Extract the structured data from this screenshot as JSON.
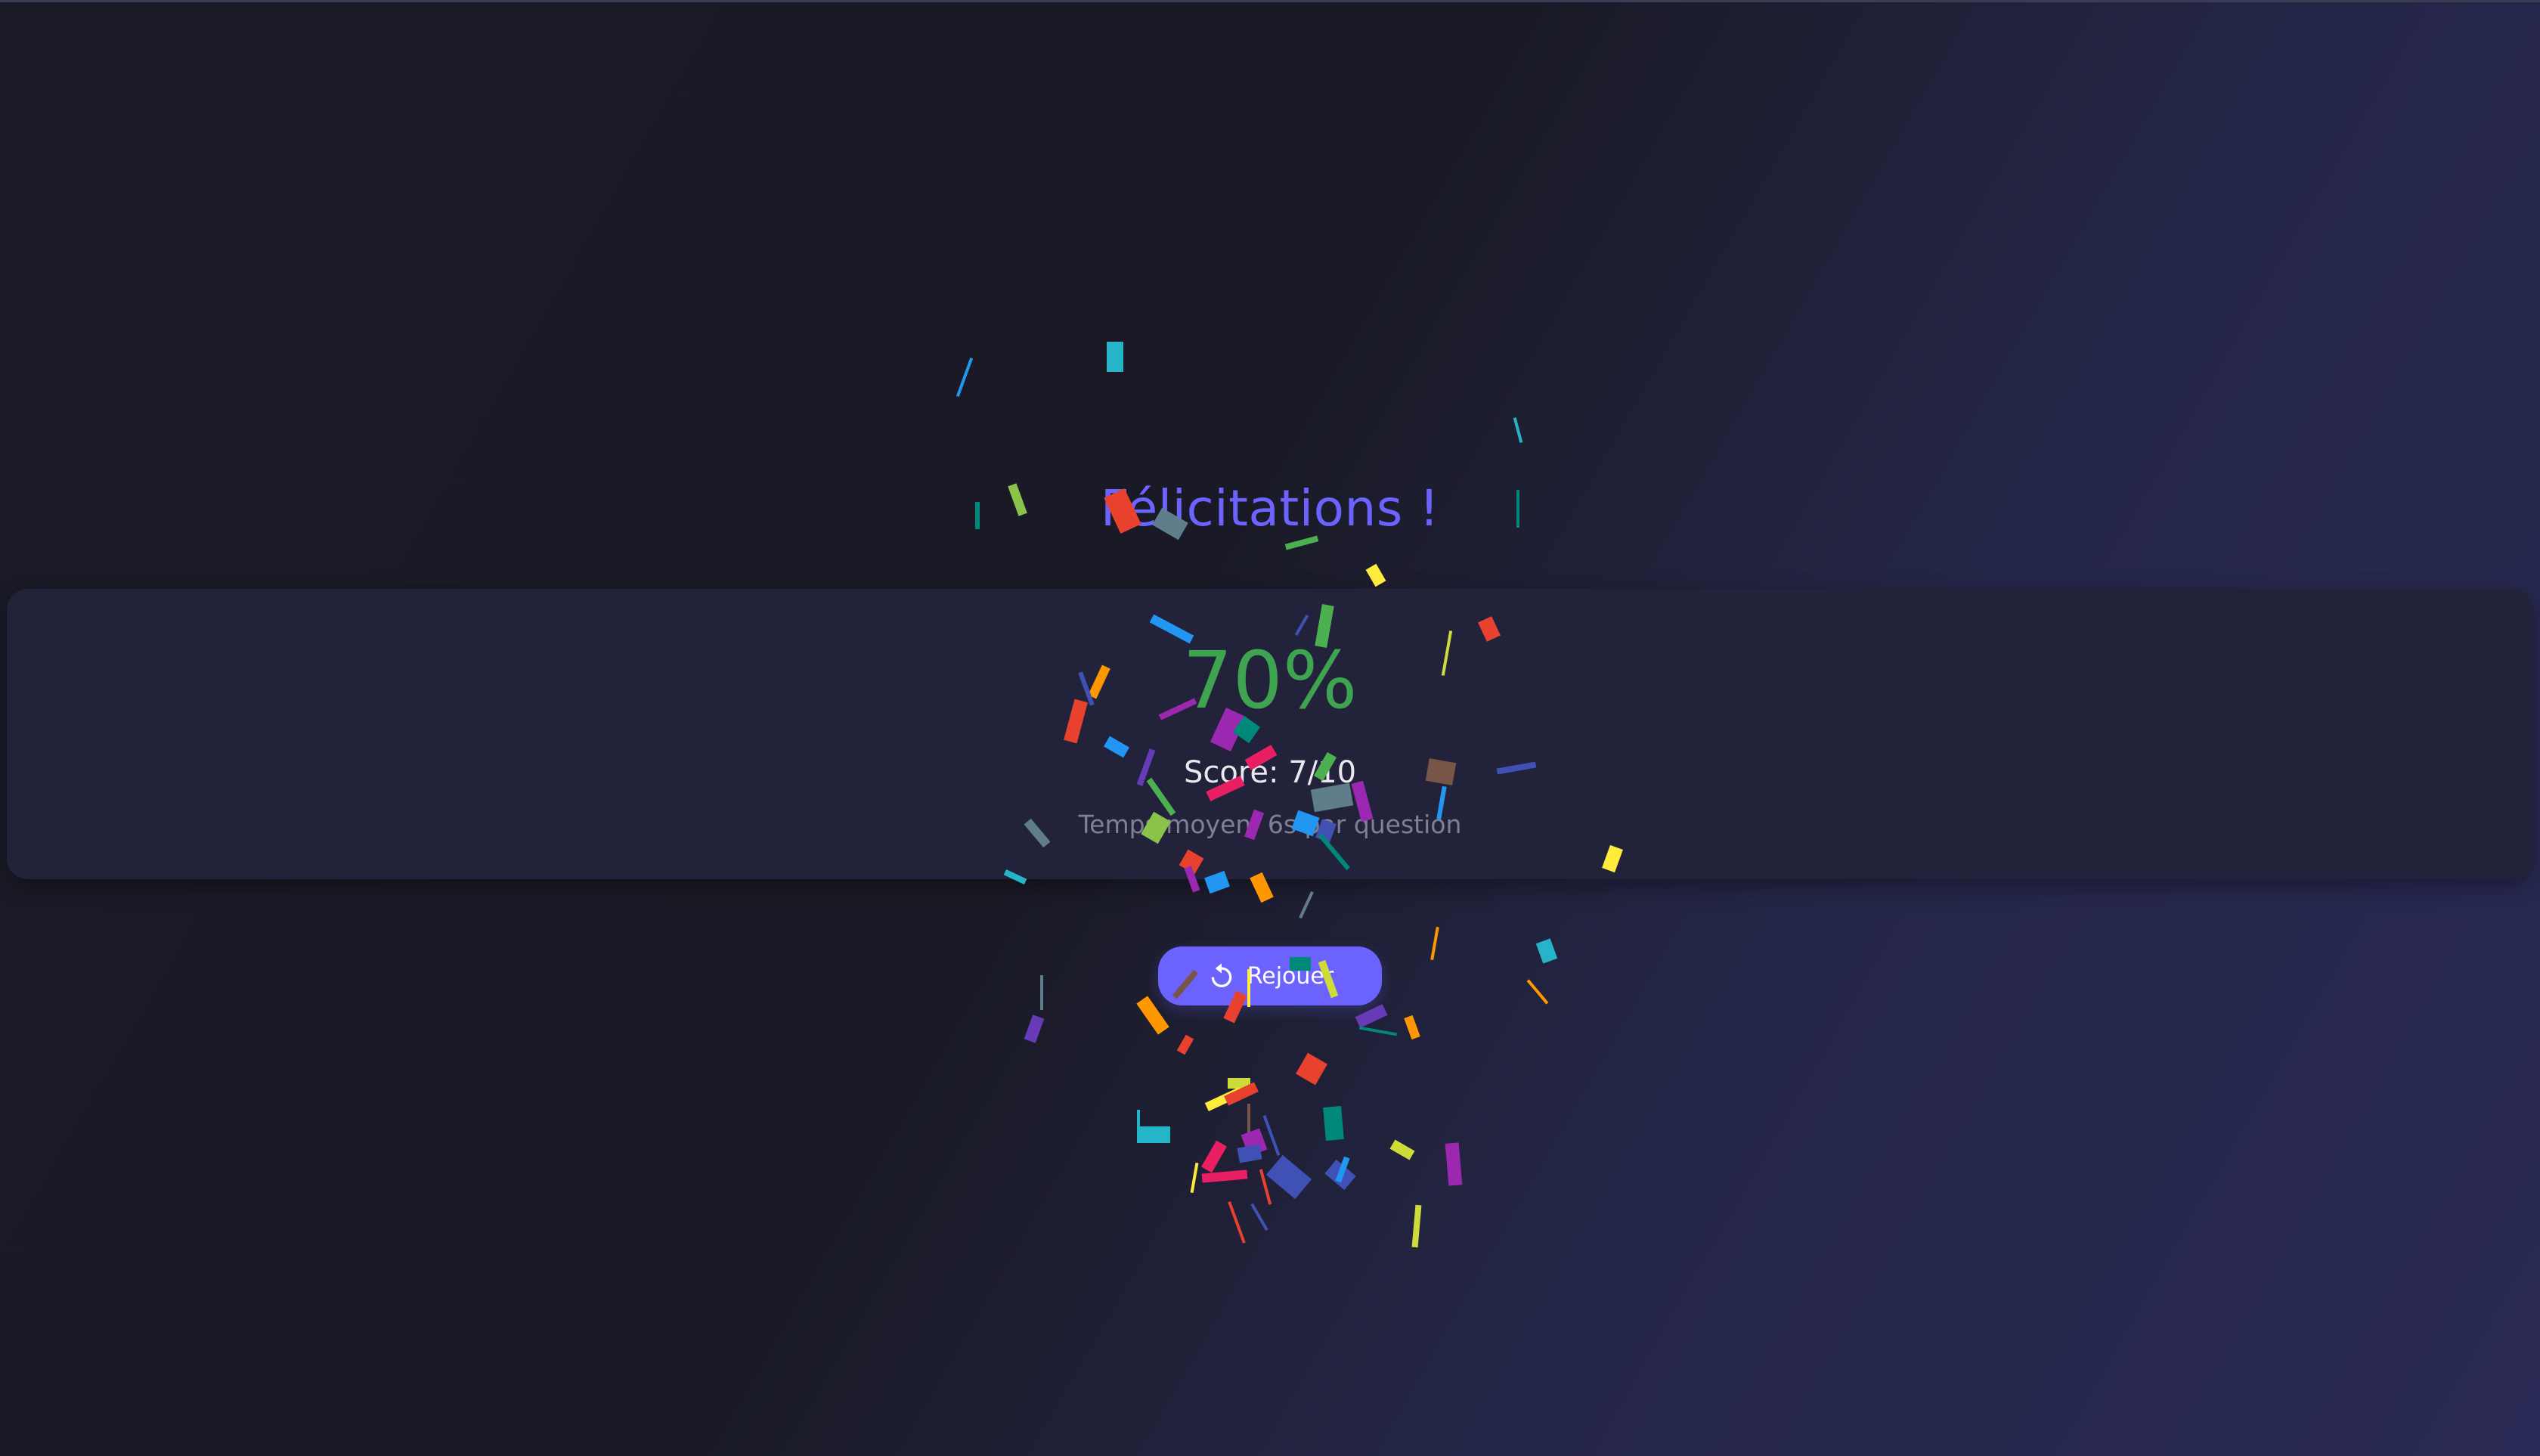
{
  "title": "Félicitations !",
  "result": {
    "percent": "70%",
    "score": "Score: 7/10",
    "avg_time": "Temps moyen: 6s par question"
  },
  "replay": {
    "label": "Rejouer",
    "icon": "refresh-icon"
  },
  "colors": {
    "accent": "#6c63ff",
    "success": "#3fa450",
    "card": "#22233a"
  },
  "confetti_colors": [
    "#2ba0c8",
    "#26b5c8",
    "#e8412d",
    "#8bc34a",
    "#9c27b0",
    "#3f51b5",
    "#ffeb3b",
    "#ff9800",
    "#4caf50",
    "#e91e63",
    "#00897b",
    "#607d8b",
    "#795548",
    "#2196f3",
    "#cddc39",
    "#673ab7"
  ]
}
